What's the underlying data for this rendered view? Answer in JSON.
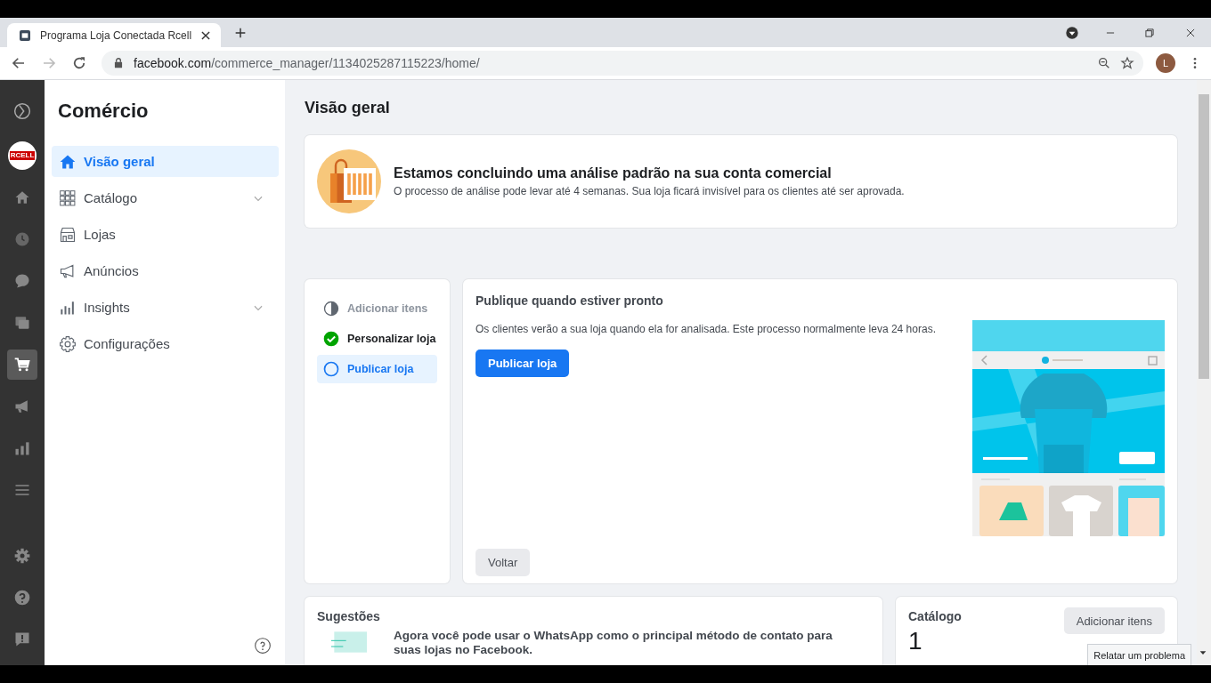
{
  "browser": {
    "tab_title": "Programa Loja Conectada Rcell",
    "url_host": "facebook.com",
    "url_path": "/commerce_manager/1134025287115223/home/",
    "profile_initial": "L"
  },
  "rail": {
    "logo_text": "RCELL",
    "items": [
      {
        "kind": "business",
        "selected": false
      },
      {
        "kind": "logo",
        "selected": false
      },
      {
        "kind": "home",
        "selected": false
      },
      {
        "kind": "clock",
        "selected": false
      },
      {
        "kind": "chat",
        "selected": false
      },
      {
        "kind": "pages",
        "selected": false
      },
      {
        "kind": "cart",
        "selected": true
      },
      {
        "kind": "megaphone",
        "selected": false
      },
      {
        "kind": "chart",
        "selected": false
      },
      {
        "kind": "menu",
        "selected": false
      }
    ],
    "bottom_items": [
      {
        "kind": "gear",
        "selected": false
      },
      {
        "kind": "help",
        "selected": false
      },
      {
        "kind": "report",
        "selected": false
      }
    ]
  },
  "sidebar": {
    "title": "Comércio",
    "items": [
      {
        "kind": "home",
        "label": "Visão geral",
        "selected": true,
        "expandable": false
      },
      {
        "kind": "grid",
        "label": "Catálogo",
        "selected": false,
        "expandable": true
      },
      {
        "kind": "store",
        "label": "Lojas",
        "selected": false,
        "expandable": false
      },
      {
        "kind": "megaphone",
        "label": "Anúncios",
        "selected": false,
        "expandable": false
      },
      {
        "kind": "chart",
        "label": "Insights",
        "selected": false,
        "expandable": true
      },
      {
        "kind": "gear",
        "label": "Configurações",
        "selected": false,
        "expandable": false
      }
    ]
  },
  "page_title": "Visão geral",
  "notice": {
    "title": "Estamos concluindo uma análise padrão na sua conta comercial",
    "text": "O processo de análise pode levar até 4 semanas. Sua loja ficará invisível para os clientes até ser aprovada."
  },
  "steps": [
    {
      "label": "Adicionar itens",
      "kind": "partial",
      "selected": false
    },
    {
      "label": "Personalizar loja",
      "kind": "done",
      "selected": false
    },
    {
      "label": "Publicar loja",
      "kind": "pending",
      "selected": true
    }
  ],
  "publish": {
    "title": "Publique quando estiver pronto",
    "text": "Os clientes verão a sua loja quando ela for analisada. Este processo normalmente leva 24 horas.",
    "primary_button": "Publicar loja",
    "back_button": "Voltar"
  },
  "suggestions": {
    "title": "Sugestões",
    "items": [
      {
        "text": "Agora você pode usar o WhatsApp como o principal método de contato para suas lojas no Facebook."
      }
    ]
  },
  "catalog": {
    "title": "Catálogo",
    "count": "1",
    "button": "Adicionar itens"
  },
  "report_button": "Relatar um problema"
}
